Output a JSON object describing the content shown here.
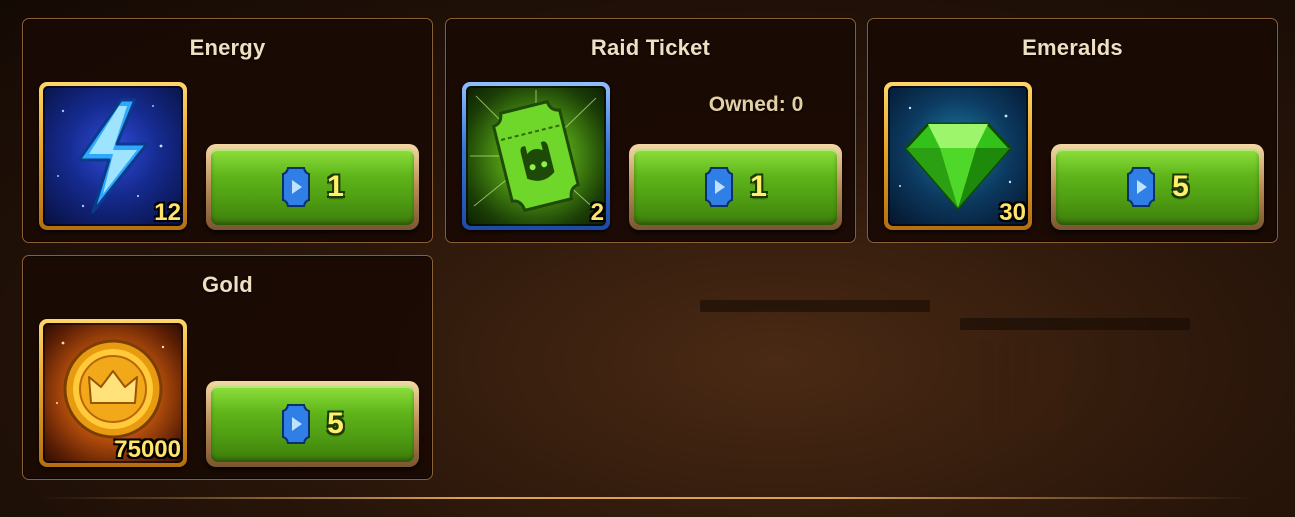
{
  "offers": [
    {
      "title": "Energy",
      "icon": "energy-bolt-icon",
      "count": "12",
      "price": "1",
      "price_icon": "ad-ticket-icon",
      "frame_color": "#e9a423"
    },
    {
      "title": "Raid Ticket",
      "icon": "raid-ticket-icon",
      "count": "2",
      "owned_label": "Owned: 0",
      "price": "1",
      "price_icon": "ad-ticket-icon",
      "frame_color": "#3a73d8"
    },
    {
      "title": "Emeralds",
      "icon": "emerald-icon",
      "count": "30",
      "price": "5",
      "price_icon": "ad-ticket-icon",
      "frame_color": "#e9a423"
    },
    {
      "title": "Gold",
      "icon": "gold-coin-icon",
      "count": "75000",
      "price": "5",
      "price_icon": "ad-ticket-icon",
      "frame_color": "#e9a423"
    }
  ],
  "colors": {
    "button_green": "#5fb51a",
    "count_yellow": "#ffe36a",
    "title_cream": "#f1dfc1"
  }
}
